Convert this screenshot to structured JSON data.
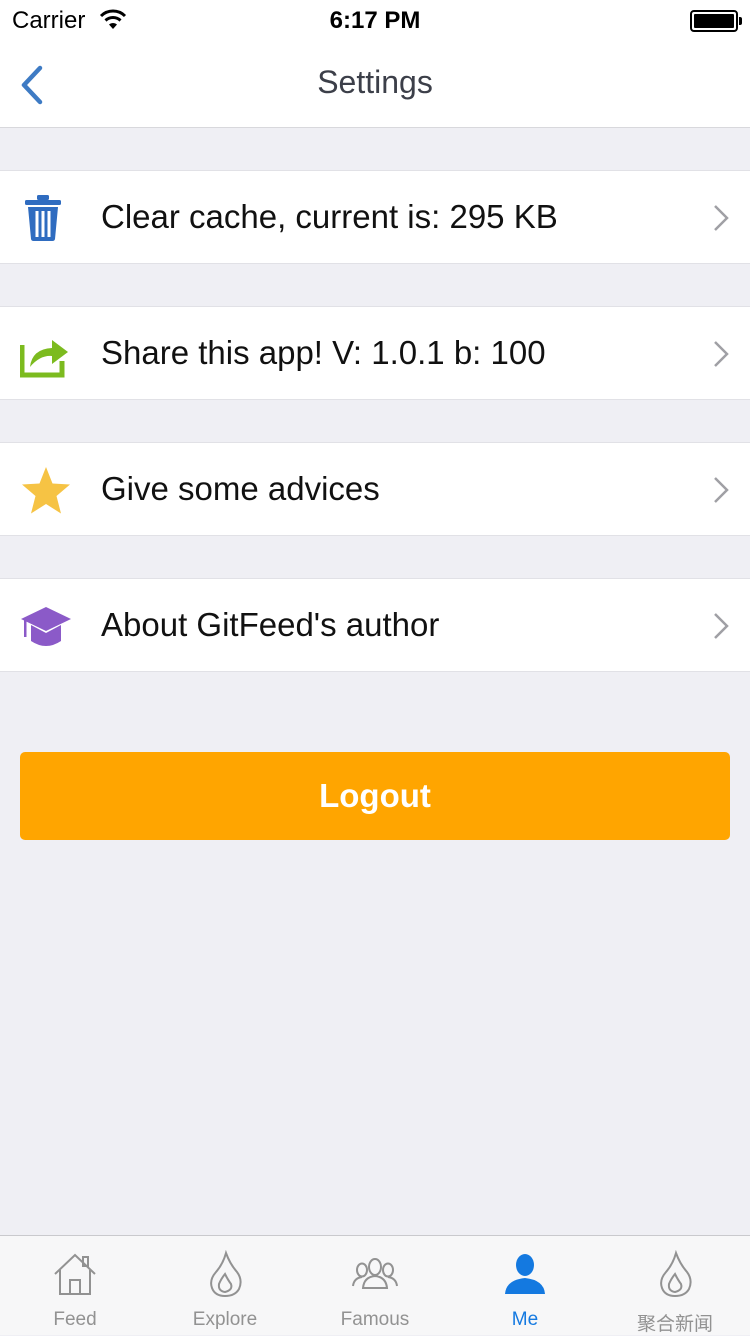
{
  "status_bar": {
    "carrier": "Carrier",
    "time": "6:17 PM"
  },
  "nav": {
    "title": "Settings",
    "back_icon": "chevron-left-icon"
  },
  "rows": [
    {
      "label": "Clear cache, current is: 295 KB",
      "icon": "trash-icon",
      "icon_color": "#2f6cc0"
    },
    {
      "label": "Share this app! V: 1.0.1 b: 100",
      "icon": "share-icon",
      "icon_color": "#7cbb1f"
    },
    {
      "label": "Give some advices",
      "icon": "star-icon",
      "icon_color": "#f6c344"
    },
    {
      "label": "About GitFeed's author",
      "icon": "graduation-cap-icon",
      "icon_color": "#8b5ac8"
    }
  ],
  "logout": {
    "label": "Logout",
    "color": "#ffa500"
  },
  "tabs": [
    {
      "label": "Feed",
      "icon": "home-icon"
    },
    {
      "label": "Explore",
      "icon": "flame-icon"
    },
    {
      "label": "Famous",
      "icon": "people-icon"
    },
    {
      "label": "Me",
      "icon": "person-icon",
      "active": true
    },
    {
      "label": "聚合新闻",
      "icon": "flame-icon"
    }
  ],
  "colors": {
    "accent": "#1479e0",
    "background": "#efeff4",
    "inactive_tab": "#929292"
  }
}
